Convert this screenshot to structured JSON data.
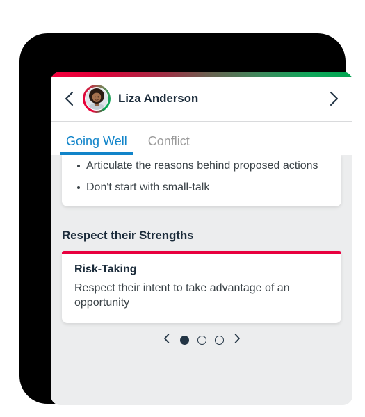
{
  "device": {
    "bezel_color": "#000000",
    "screen_bg": "#ecedee"
  },
  "accent_gradient": {
    "from": "#f4003c",
    "to": "#00a651"
  },
  "header": {
    "prev_icon": "chevron-left-icon",
    "next_icon": "chevron-right-icon",
    "avatar_alt": "Liza Anderson profile photo",
    "person_name": "Liza Anderson"
  },
  "tabs": [
    {
      "label": "Going Well",
      "active": true,
      "color": "#1184c9"
    },
    {
      "label": "Conflict",
      "active": false,
      "color": "#9b9b9b"
    }
  ],
  "tips_card": {
    "bullets": [
      "Articulate the reasons behind proposed actions",
      "Don't start with small-talk"
    ]
  },
  "strengths_section": {
    "title": "Respect their Strengths",
    "accent_color": "#e8003f",
    "card": {
      "heading": "Risk-Taking",
      "text": "Respect their intent to take advantage of an opportunity"
    }
  },
  "pager": {
    "prev_icon": "chevron-left-icon",
    "next_icon": "chevron-right-icon",
    "total": 3,
    "current": 1,
    "dots": [
      {
        "filled": true
      },
      {
        "filled": false
      },
      {
        "filled": false
      }
    ]
  }
}
